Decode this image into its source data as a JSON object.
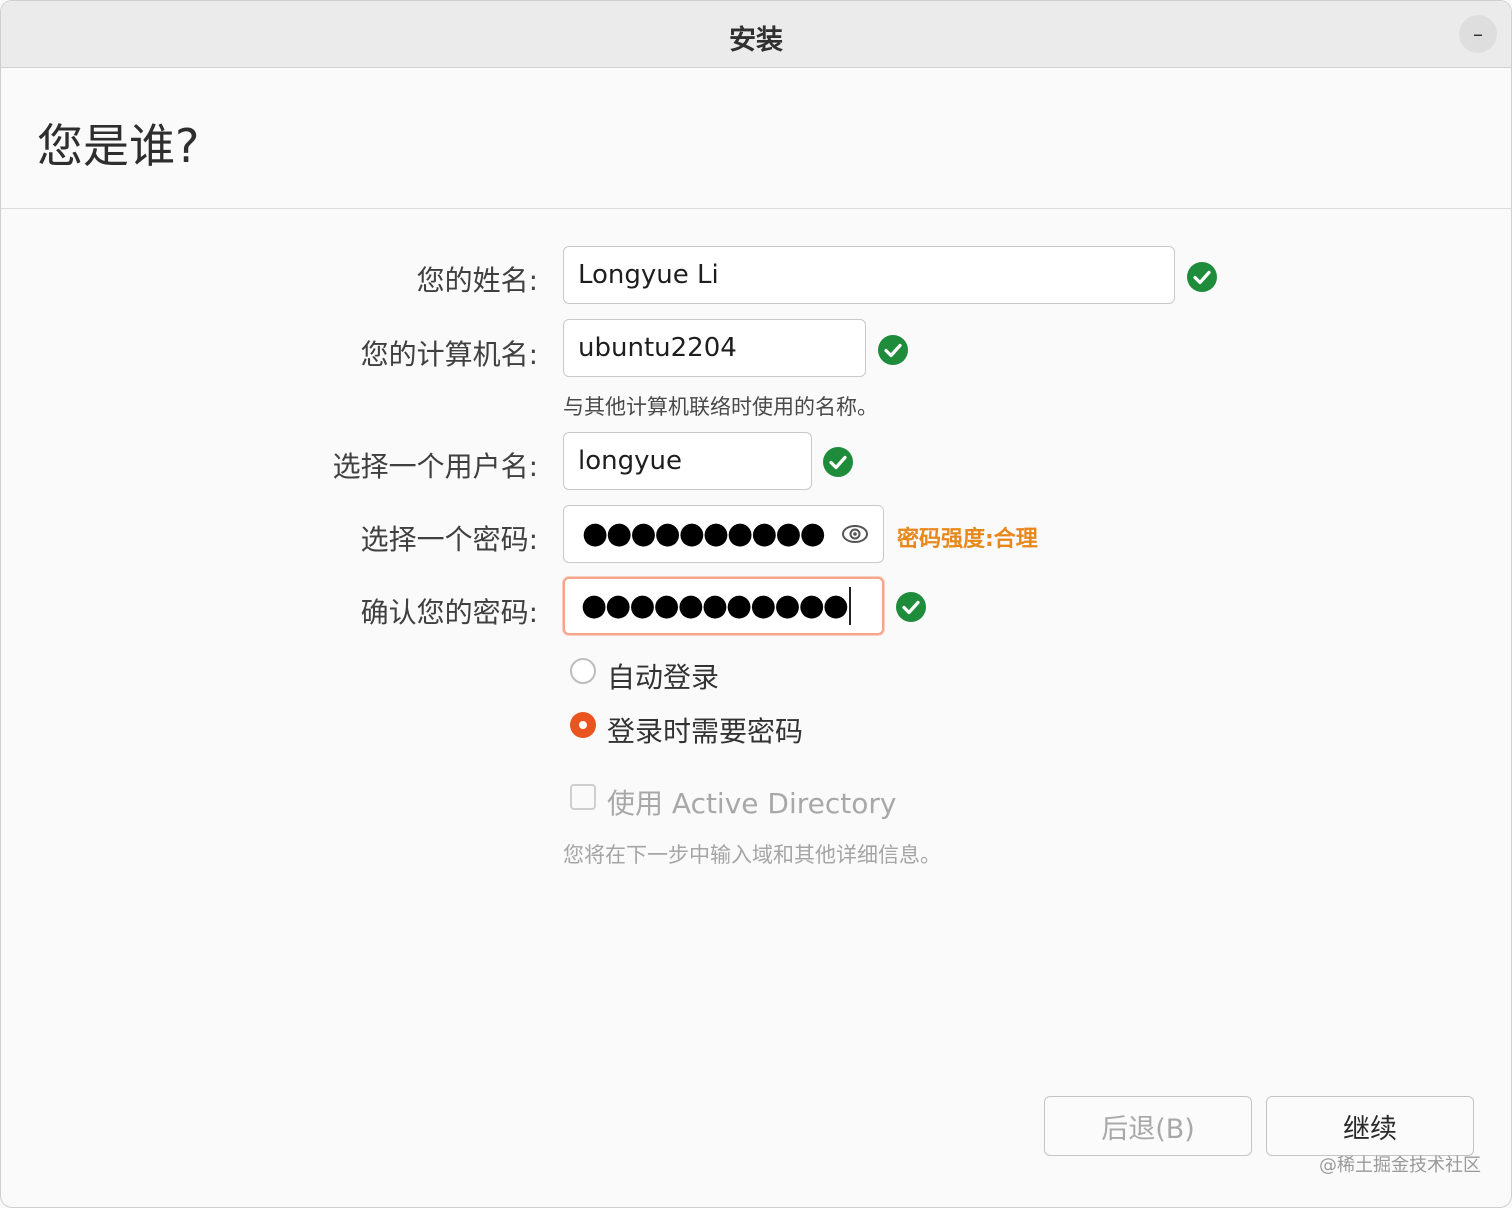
{
  "window": {
    "title": "安装",
    "minimize_label": "–"
  },
  "page": {
    "heading": "您是谁?"
  },
  "form": {
    "name": {
      "label": "您的姓名:",
      "value": "Longyue Li"
    },
    "computer": {
      "label": "您的计算机名:",
      "value": "ubuntu2204",
      "hint": "与其他计算机联络时使用的名称。"
    },
    "username": {
      "label": "选择一个用户名:",
      "value": "longyue"
    },
    "password": {
      "label": "选择一个密码:",
      "masked_value": "●●●●●●●●●●",
      "strength": "密码强度:合理"
    },
    "confirm": {
      "label": "确认您的密码:",
      "masked_value": "●●●●●●●●●●●"
    },
    "login_options": [
      {
        "label": "自动登录",
        "selected": false
      },
      {
        "label": "登录时需要密码",
        "selected": true
      }
    ],
    "active_directory": {
      "label": "使用 Active Directory",
      "checked": false,
      "hint": "您将在下一步中输入域和其他详细信息。"
    }
  },
  "buttons": {
    "back": "后退(B)",
    "continue": "继续"
  },
  "watermark": "@稀土掘金技术社区",
  "colors": {
    "accent": "#e9541f",
    "valid": "#1f8c3b",
    "strength_text": "#e8881a",
    "focus_border": "#f4a58a"
  }
}
